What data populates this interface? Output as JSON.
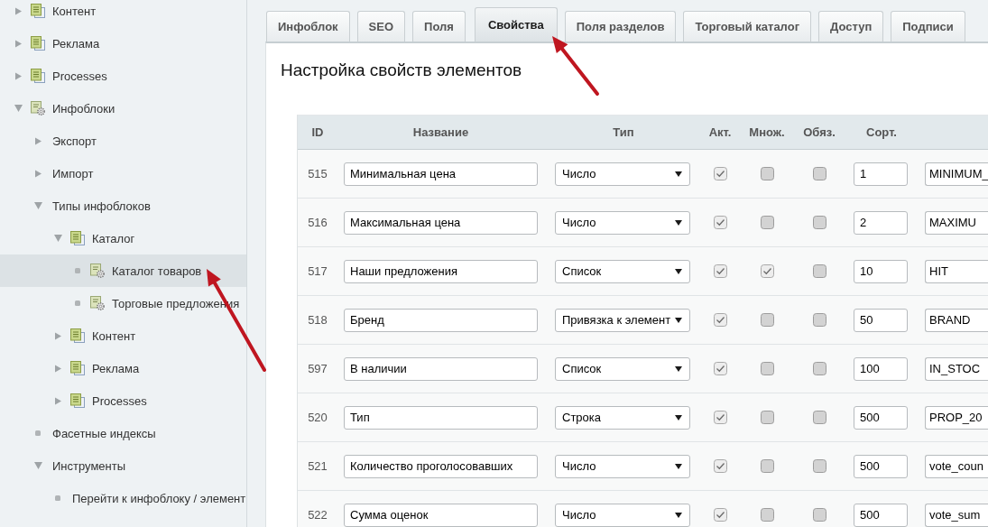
{
  "sidebar": {
    "items": [
      {
        "label": "Контент",
        "kind": "section",
        "expanded": false,
        "selected": false
      },
      {
        "label": "Реклама",
        "kind": "section",
        "expanded": false,
        "selected": false
      },
      {
        "label": "Processes",
        "kind": "section",
        "expanded": false,
        "selected": false
      },
      {
        "label": "Инфоблоки",
        "kind": "iblock",
        "expanded": true,
        "selected": false,
        "children": [
          {
            "label": "Экспорт",
            "kind": "page",
            "expanded": false,
            "selected": false
          },
          {
            "label": "Импорт",
            "kind": "page",
            "expanded": false,
            "selected": false
          },
          {
            "label": "Типы инфоблоков",
            "kind": "page",
            "expanded": true,
            "selected": false,
            "children": [
              {
                "label": "Каталог",
                "kind": "section",
                "expanded": true,
                "selected": false,
                "children": [
                  {
                    "label": "Каталог товаров",
                    "kind": "iblock",
                    "selected": true
                  },
                  {
                    "label": "Торговые предложения",
                    "kind": "iblock",
                    "selected": false
                  }
                ]
              },
              {
                "label": "Контент",
                "kind": "section",
                "expanded": false,
                "selected": false
              },
              {
                "label": "Реклама",
                "kind": "section",
                "expanded": false,
                "selected": false
              },
              {
                "label": "Processes",
                "kind": "section",
                "expanded": false,
                "selected": false
              }
            ]
          },
          {
            "label": "Фасетные индексы",
            "kind": "page",
            "selected": false
          },
          {
            "label": "Инструменты",
            "kind": "page",
            "expanded": true,
            "selected": false,
            "children": [
              {
                "label": "Перейти к инфоблоку / элемент",
                "kind": "page",
                "selected": false
              }
            ]
          }
        ]
      }
    ]
  },
  "tabs": [
    {
      "label": "Инфоблок",
      "selected": false
    },
    {
      "label": "SEO",
      "selected": false
    },
    {
      "label": "Поля",
      "selected": false
    },
    {
      "label": "Свойства",
      "selected": true
    },
    {
      "label": "Поля разделов",
      "selected": false
    },
    {
      "label": "Торговый каталог",
      "selected": false
    },
    {
      "label": "Доступ",
      "selected": false
    },
    {
      "label": "Подписи",
      "selected": false
    }
  ],
  "panel": {
    "title": "Настройка свойств элементов"
  },
  "table": {
    "columns": [
      "ID",
      "Название",
      "Тип",
      "Акт.",
      "Множ.",
      "Обяз.",
      "Сорт."
    ],
    "rows": [
      {
        "id": "515",
        "name": "Минимальная цена",
        "type": "Число",
        "active": true,
        "multiple": false,
        "required": false,
        "sort": "1",
        "code": "MINIMUM_"
      },
      {
        "id": "516",
        "name": "Максимальная цена",
        "type": "Число",
        "active": true,
        "multiple": false,
        "required": false,
        "sort": "2",
        "code": "MAXIMU"
      },
      {
        "id": "517",
        "name": "Наши предложения",
        "type": "Список",
        "active": true,
        "multiple": true,
        "required": false,
        "sort": "10",
        "code": "HIT"
      },
      {
        "id": "518",
        "name": "Бренд",
        "type": "Привязка к элемент",
        "active": true,
        "multiple": false,
        "required": false,
        "sort": "50",
        "code": "BRAND"
      },
      {
        "id": "597",
        "name": "В наличии",
        "type": "Список",
        "active": true,
        "multiple": false,
        "required": false,
        "sort": "100",
        "code": "IN_STOC"
      },
      {
        "id": "520",
        "name": "Тип",
        "type": "Строка",
        "active": true,
        "multiple": false,
        "required": false,
        "sort": "500",
        "code": "PROP_20"
      },
      {
        "id": "521",
        "name": "Количество проголосовавших",
        "type": "Число",
        "active": true,
        "multiple": false,
        "required": false,
        "sort": "500",
        "code": "vote_coun"
      },
      {
        "id": "522",
        "name": "Сумма оценок",
        "type": "Число",
        "active": true,
        "multiple": false,
        "required": false,
        "sort": "500",
        "code": "vote_sum"
      }
    ]
  }
}
